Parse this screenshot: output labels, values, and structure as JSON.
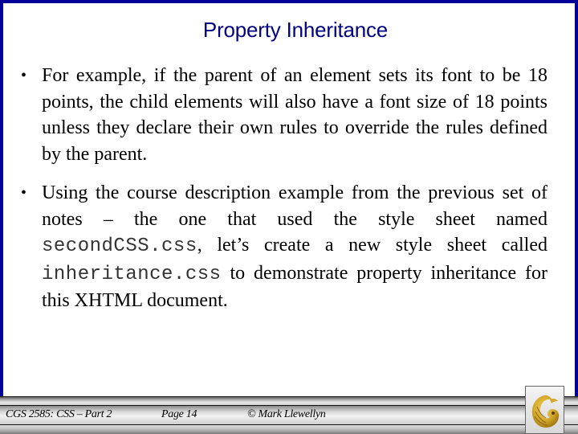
{
  "slide": {
    "title": "Property Inheritance",
    "bullets": [
      {
        "text": "For example, if the parent of an element sets its font to be 18 points, the child elements will also have a font size of 18 points unless they declare their own rules to override the rules defined by the parent."
      },
      {
        "text_before": "Using the  course description example from the previous set of notes – the one that used the style sheet named ",
        "code_1": "secondCSS.css",
        "text_middle": ", let’s create a new style sheet called ",
        "code_2": "inheritance.css",
        "text_after": " to demonstrate property inheritance for this XHTML document."
      }
    ],
    "bullet_glyph": "•"
  },
  "footer": {
    "course": "CGS 2585: CSS – Part 2",
    "page": "Page 14",
    "author": "© Mark Llewellyn",
    "logo_icon": "ucf-pegasus-logo-icon"
  },
  "colors": {
    "border": "#000099",
    "title": "#000080",
    "logo_gold": "#c9a227"
  }
}
